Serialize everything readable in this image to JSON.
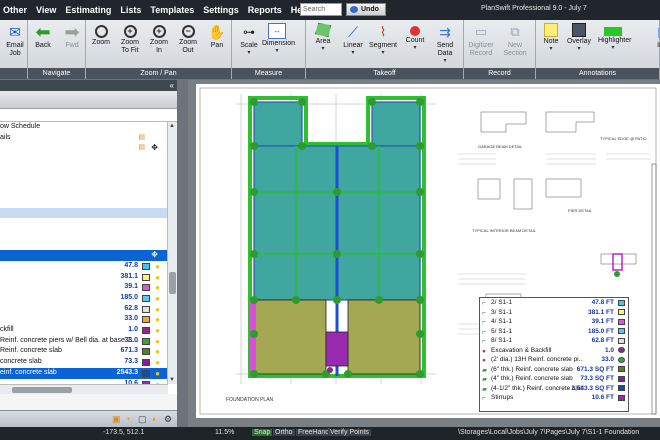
{
  "menu": [
    "Other",
    "View",
    "Estimating",
    "Lists",
    "Templates",
    "Settings",
    "Reports",
    "Help"
  ],
  "search": {
    "placeholder": "Search"
  },
  "undo_label": "Undo",
  "app_title": "PlanSwift Professional 9.0 - July 7",
  "ribbon": {
    "groups": [
      {
        "label": "",
        "tools": [
          {
            "label": "Email\nJob",
            "icon": "envelope-icon",
            "enabled": true
          }
        ]
      },
      {
        "label": "Navigate",
        "tools": [
          {
            "label": "Back",
            "icon": "arrow-left-icon",
            "enabled": true
          },
          {
            "label": "Fwd",
            "icon": "arrow-right-icon",
            "enabled": false
          }
        ]
      },
      {
        "label": "Zoom / Pan",
        "tools": [
          {
            "label": "Zoom",
            "icon": "magnifier-icon",
            "enabled": true
          },
          {
            "label": "Zoom\nTo Fit",
            "icon": "zoom-fit-icon",
            "enabled": true
          },
          {
            "label": "Zoom\nIn",
            "icon": "zoom-in-icon",
            "enabled": true
          },
          {
            "label": "Zoom\nOut",
            "icon": "zoom-out-icon",
            "enabled": true
          },
          {
            "label": "Pan",
            "icon": "hand-icon",
            "enabled": true
          }
        ]
      },
      {
        "label": "Measure",
        "tools": [
          {
            "label": "Scale",
            "icon": "scale-icon",
            "enabled": true
          },
          {
            "label": "Dimension",
            "icon": "dimension-icon",
            "enabled": true
          }
        ]
      },
      {
        "label": "Takeoff",
        "tools": [
          {
            "label": "Area",
            "icon": "area-icon",
            "enabled": true
          },
          {
            "label": "Linear",
            "icon": "linear-icon",
            "enabled": true
          },
          {
            "label": "Segment",
            "icon": "segment-icon",
            "enabled": true
          },
          {
            "label": "Count",
            "icon": "count-icon",
            "enabled": true
          },
          {
            "label": "Send\nData",
            "icon": "send-data-icon",
            "enabled": true
          }
        ]
      },
      {
        "label": "Record",
        "tools": [
          {
            "label": "Digitizer\nRecord",
            "icon": "digitizer-icon",
            "enabled": false
          },
          {
            "label": "New\nSection",
            "icon": "new-section-icon",
            "enabled": false
          }
        ]
      },
      {
        "label": "Annotations",
        "tools": [
          {
            "label": "Note",
            "icon": "note-icon",
            "enabled": true
          },
          {
            "label": "Overlay",
            "icon": "overlay-icon",
            "enabled": true
          },
          {
            "label": "Highlighter",
            "icon": "highlighter-icon",
            "enabled": true
          },
          {
            "label": "Ima",
            "icon": "image-icon",
            "enabled": true
          }
        ]
      }
    ]
  },
  "tree": [
    {
      "label": "ow Schedule",
      "style": ""
    },
    {
      "label": "ails",
      "style": "",
      "lock": true,
      "move": false
    },
    {
      "label": "",
      "style": "",
      "lock": true,
      "move": true
    },
    {
      "label": "",
      "style": ""
    },
    {
      "label": "",
      "style": ""
    },
    {
      "label": "",
      "style": ""
    },
    {
      "label": "",
      "style": ""
    },
    {
      "label": "",
      "style": ""
    },
    {
      "label": "",
      "style": "sel2"
    },
    {
      "label": "",
      "style": ""
    },
    {
      "label": "",
      "style": ""
    },
    {
      "label": "",
      "style": ""
    },
    {
      "label": "",
      "style": "sel",
      "move": true
    },
    {
      "label": "",
      "style": "",
      "value": "47.8",
      "color": "#43c7e8"
    },
    {
      "label": "",
      "style": "",
      "value": "381.1",
      "color": "#f5f57a"
    },
    {
      "label": "",
      "style": "",
      "value": "39.1",
      "color": "#e055e0"
    },
    {
      "label": "",
      "style": "",
      "value": "185.0",
      "color": "#58c8f2"
    },
    {
      "label": "",
      "style": "",
      "value": "62.8",
      "color": "#e0e0e0"
    },
    {
      "label": "",
      "style": "",
      "value": "33.0",
      "color": "#f2a23a"
    },
    {
      "label": "ckfill",
      "style": "",
      "value": "1.0",
      "color": "#8c2b8c"
    },
    {
      "label": "Reinf. concrete piers w/ Bell dia. at base 7....",
      "style": "",
      "value": "33.0",
      "color": "#3aa43a"
    },
    {
      "label": "Reinf. concrete slab",
      "style": "",
      "value": "671.3",
      "color": "#5a7d2a"
    },
    {
      "label": "concrete slab",
      "style": "",
      "value": "73.3",
      "color": "#8b1aa0"
    },
    {
      "label": "einf. concrete slab",
      "style": "sel",
      "value": "2543.3",
      "color": "#0d4fa8"
    },
    {
      "label": "",
      "style": "",
      "value": "10.6",
      "color": "#9a2ab0"
    }
  ],
  "legend": [
    {
      "icon": "linear-icon",
      "name": "2/ S1-1",
      "value": "47.8 FT",
      "color": "#43c7e8"
    },
    {
      "icon": "linear-icon",
      "name": "3/ S1-1",
      "value": "381.1 FT",
      "color": "#f5f57a"
    },
    {
      "icon": "linear-icon",
      "name": "4/ S1-1",
      "value": "39.1 FT",
      "color": "#e055e0"
    },
    {
      "icon": "linear-icon",
      "name": "5/ S1-1",
      "value": "185.0 FT",
      "color": "#58c8f2"
    },
    {
      "icon": "linear-icon",
      "name": "8/ S1-1",
      "value": "62.8 FT",
      "color": "#e0e0e0"
    },
    {
      "icon": "count-icon",
      "name": "Excavation & Backfill",
      "value": "1.0",
      "color": "#8c2b8c"
    },
    {
      "icon": "count-icon",
      "name": "(2' dia.) 13H Reinf. concrete pi...",
      "value": "33.0",
      "color": "#3aa43a"
    },
    {
      "icon": "area-icon",
      "name": "(6\" thk.) Reinf. concrete slab",
      "value": "671.3 SQ FT",
      "color": "#5a7d2a"
    },
    {
      "icon": "area-icon",
      "name": "(4\" thk.) Reinf. concrete slab",
      "value": "73.3 SQ FT",
      "color": "#8b1aa0"
    },
    {
      "icon": "area-icon",
      "name": "(4-1/2\" thk.) Reinf. concrete slab",
      "value": "2,543.3 SQ FT",
      "color": "#0d4fa8"
    },
    {
      "icon": "linear-icon",
      "name": "Stirrups",
      "value": "10.6 FT",
      "color": "#9a2ab0"
    }
  ],
  "drawing": {
    "foundation_label": "FOUNDATION PLAN",
    "details": [
      "GARAGE BEAM DETAIL",
      "PIER DETAIL",
      "TYPICAL INTERIOR BEAM DETAIL",
      "TYPICAL EDGE @ PATIO"
    ]
  },
  "status": {
    "coords": "-173.5, 512.1",
    "zoom": "11.5%",
    "snap": "Snap",
    "ortho": "Ortho",
    "freehand": "FreeHand",
    "verify": "Verify Points",
    "path": "\\Storages\\Local\\Jobs\\July 7\\Pages\\July 7\\S1-1 Foundation"
  }
}
